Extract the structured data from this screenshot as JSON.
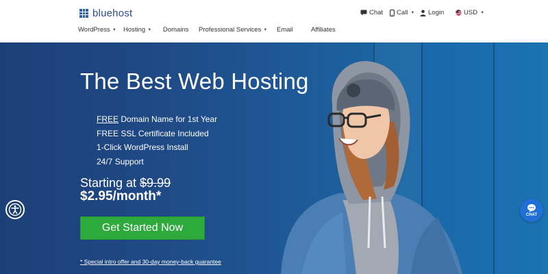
{
  "brand": {
    "name": "bluehost",
    "color": "#2f5fb3"
  },
  "utility": {
    "chat": {
      "label": "Chat",
      "icon": "chat-icon"
    },
    "call": {
      "label": "Call",
      "icon": "phone-icon"
    },
    "login": {
      "label": "Login",
      "icon": "user-icon"
    },
    "currency": {
      "label": "USD",
      "icon": "flag-icon"
    }
  },
  "nav": {
    "items": [
      {
        "label": "WordPress",
        "dropdown": true
      },
      {
        "label": "Hosting",
        "dropdown": true
      },
      {
        "label": "Domains",
        "dropdown": false
      },
      {
        "label": "Professional Services",
        "dropdown": true
      },
      {
        "label": "Email",
        "dropdown": false
      },
      {
        "label": "Affiliates",
        "dropdown": false
      }
    ]
  },
  "hero": {
    "title": "The Best Web Hosting",
    "features": [
      {
        "highlight": "FREE",
        "rest": " Domain Name for 1st Year"
      },
      {
        "text": "FREE SSL Certificate Included"
      },
      {
        "text": "1-Click WordPress Install"
      },
      {
        "text": "24/7 Support"
      }
    ],
    "price_prefix": "Starting at ",
    "old_price": "$9.99",
    "price": "$2.95/month*",
    "cta_label": "Get Started Now",
    "cta_color": "#2eaa3d",
    "disclaimer": "* Special intro offer and 30-day money-back guarantee"
  },
  "widgets": {
    "accessibility_icon": "accessibility-icon",
    "chat_label": "CHAT",
    "chat_icon": "chat-bubble-icon",
    "chat_color": "#1f6fd6"
  }
}
